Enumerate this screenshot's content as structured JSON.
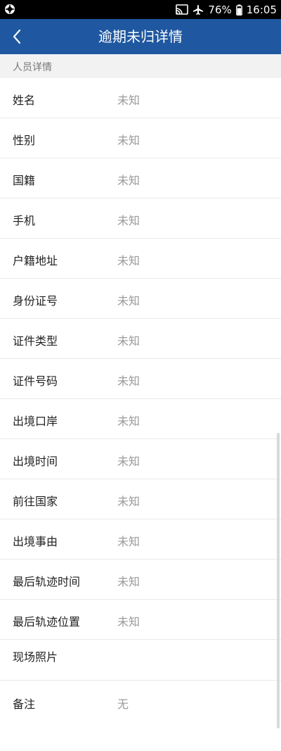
{
  "status_bar": {
    "battery": "76%",
    "time": "16:05",
    "icons": [
      "app-notification-icon",
      "cast-icon",
      "airplane-icon",
      "battery-icon"
    ]
  },
  "header": {
    "title": "逾期未归详情",
    "back_icon": "chevron-left-icon",
    "color": "#1f58a0"
  },
  "section": {
    "title": "人员详情"
  },
  "fields": [
    {
      "label": "姓名",
      "value": "未知"
    },
    {
      "label": "性别",
      "value": "未知"
    },
    {
      "label": "国籍",
      "value": "未知"
    },
    {
      "label": "手机",
      "value": "未知"
    },
    {
      "label": "户籍地址",
      "value": "未知"
    },
    {
      "label": "身份证号",
      "value": "未知"
    },
    {
      "label": "证件类型",
      "value": "未知"
    },
    {
      "label": "证件号码",
      "value": "未知"
    },
    {
      "label": "出境口岸",
      "value": "未知"
    },
    {
      "label": "出境时间",
      "value": "未知"
    },
    {
      "label": "前往国家",
      "value": "未知"
    },
    {
      "label": "出境事由",
      "value": "未知"
    },
    {
      "label": "最后轨迹时间",
      "value": "未知"
    },
    {
      "label": "最后轨迹位置",
      "value": "未知"
    }
  ],
  "photo": {
    "label": "现场照片"
  },
  "remark": {
    "label": "备注",
    "value": "无"
  }
}
